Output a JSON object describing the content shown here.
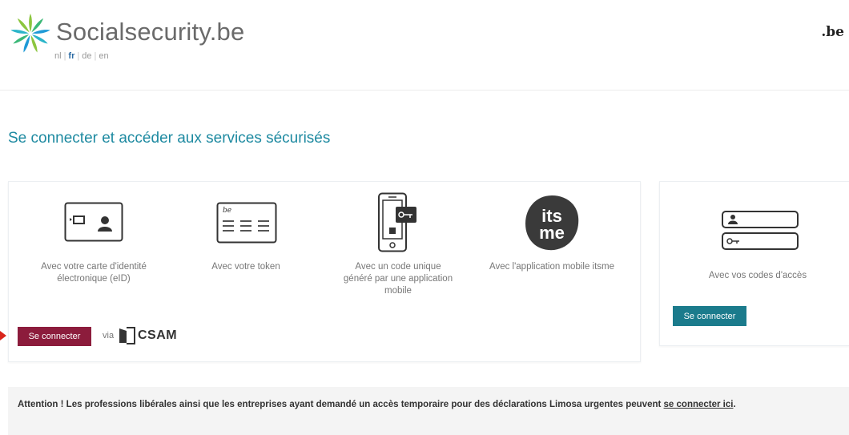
{
  "header": {
    "brand": "Socialsecurity.be",
    "languages": [
      {
        "code": "nl",
        "active": false
      },
      {
        "code": "fr",
        "active": true
      },
      {
        "code": "de",
        "active": false
      },
      {
        "code": "en",
        "active": false
      }
    ],
    "be_mark": ".be"
  },
  "page_title": "Se connecter et accéder aux services sécurisés",
  "methods": [
    {
      "label": "Avec votre carte d'identité électronique (eID)",
      "icon": "eid-card-icon"
    },
    {
      "label": "Avec votre token",
      "icon": "token-card-icon"
    },
    {
      "label": "Avec un code unique généré par une application mobile",
      "icon": "mobile-code-icon"
    },
    {
      "label": "Avec l'application mobile itsme",
      "icon": "itsme-logo"
    }
  ],
  "csam": {
    "button_label": "Se connecter",
    "via_label": "via",
    "logo_text": "CSAM"
  },
  "codes": {
    "label": "Avec vos codes d'accès",
    "button_label": "Se connecter",
    "icon": "access-codes-icon"
  },
  "itsme_logo_text": {
    "line1": "its",
    "line2": "me"
  },
  "notice": {
    "text": "Attention ! Les professions libérales ainsi que les entreprises ayant demandé un accès temporaire pour des déclarations Limosa urgentes peuvent ",
    "link_text": "se connecter ici",
    "end": "."
  },
  "colors": {
    "title": "#1e8aa1",
    "csam_button": "#8c1c3c",
    "codes_button": "#1b7b8c",
    "arrow": "#d9261c"
  }
}
